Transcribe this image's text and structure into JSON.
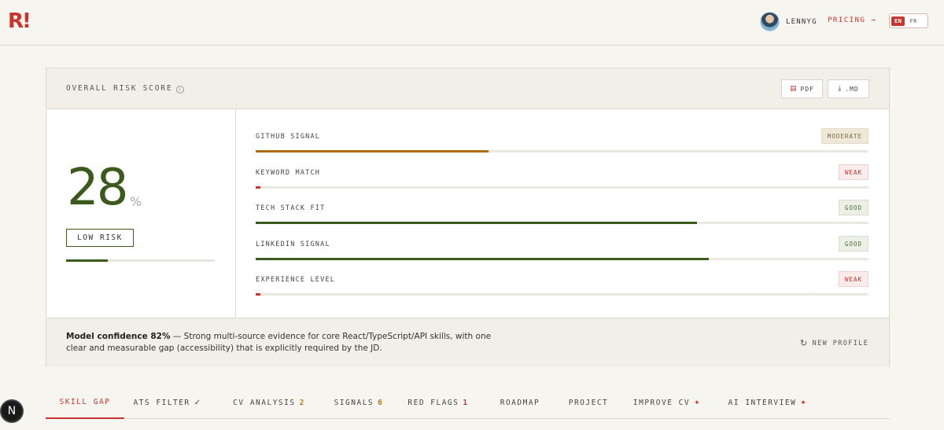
{
  "header": {
    "logo": "R!",
    "username": "LENNYG",
    "pricing_label": "PRICING →",
    "lang_active": "EN",
    "lang_inactive": "FR"
  },
  "card": {
    "title": "OVERALL RISK SCORE",
    "pdf_label": "PDF",
    "md_label": ".MD",
    "score": "28",
    "score_unit": "%",
    "risk_label": "LOW RISK",
    "risk_fraction": 0.28,
    "signals": [
      {
        "label": "GITHUB SIGNAL",
        "status": "MODERATE",
        "level": "moderate",
        "fraction": 0.38
      },
      {
        "label": "KEYWORD MATCH",
        "status": "WEAK",
        "level": "weak",
        "fraction": 0.008
      },
      {
        "label": "TECH STACK FIT",
        "status": "GOOD",
        "level": "good",
        "fraction": 0.72
      },
      {
        "label": "LINKEDIN SIGNAL",
        "status": "GOOD",
        "level": "good",
        "fraction": 0.74
      },
      {
        "label": "EXPERIENCE LEVEL",
        "status": "WEAK",
        "level": "weak",
        "fraction": 0.008
      }
    ],
    "confidence_bold": "Model confidence 82%",
    "confidence_text": " — Strong multi-source evidence for core React/TypeScript/API skills, with one clear and measurable gap (accessibility) that is explicitly required by the JD.",
    "new_profile_label": "NEW PROFILE"
  },
  "tabs": [
    {
      "label": "SKILL GAP",
      "suffix": "",
      "suffix_type": "none",
      "active": true
    },
    {
      "label": "ATS FILTER",
      "suffix": "✓",
      "suffix_type": "check",
      "active": false
    },
    {
      "label": "CV ANALYSIS",
      "suffix": "2",
      "suffix_type": "amber",
      "active": false
    },
    {
      "label": "SIGNALS",
      "suffix": "6",
      "suffix_type": "amber",
      "active": false
    },
    {
      "label": "RED FLAGS",
      "suffix": "1",
      "suffix_type": "red",
      "active": false
    },
    {
      "label": "ROADMAP",
      "suffix": "",
      "suffix_type": "none",
      "active": false
    },
    {
      "label": "PROJECT",
      "suffix": "",
      "suffix_type": "none",
      "active": false
    },
    {
      "label": "IMPROVE CV",
      "suffix": "✦",
      "suffix_type": "spark",
      "active": false
    },
    {
      "label": "AI INTERVIEW",
      "suffix": "✦",
      "suffix_type": "spark",
      "active": false
    }
  ],
  "dev_badge": "N",
  "colors": {
    "accent": "#c8352e",
    "good": "#3d5a1e",
    "moderate": "#b06a10",
    "weak": "#c8352e"
  }
}
